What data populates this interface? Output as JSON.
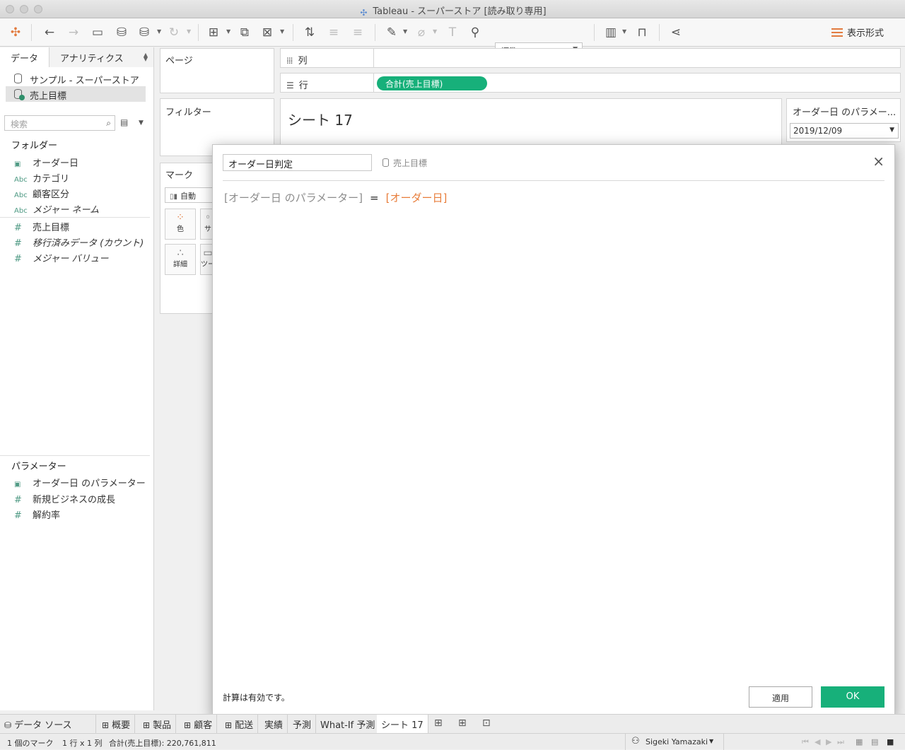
{
  "window": {
    "title": "Tableau - スーパーストア [読み取り専用]"
  },
  "toolbar": {
    "fit_value": "標準",
    "show_me_label": "表示形式"
  },
  "data_pane": {
    "tabs": [
      "データ",
      "アナリティクス"
    ],
    "data_sources": [
      "サンプル - スーパーストア",
      "売上目標"
    ],
    "search_placeholder": "検索",
    "folder_title": "フォルダー",
    "dimensions": [
      {
        "icon": "calendar-icon",
        "label": "オーダー日"
      },
      {
        "icon": "abc-icon",
        "icon_text": "Abc",
        "label": "カテゴリ"
      },
      {
        "icon": "abc-icon",
        "icon_text": "Abc",
        "label": "顧客区分"
      },
      {
        "icon": "abc-icon",
        "icon_text": "Abc",
        "label": "メジャー ネーム"
      }
    ],
    "measures": [
      {
        "icon": "number-icon",
        "icon_text": "#",
        "label": "売上目標"
      },
      {
        "icon": "number-icon",
        "icon_text": "#",
        "label": "移行済みデータ (カウント)"
      },
      {
        "icon": "number-icon",
        "icon_text": "#",
        "label": "メジャー バリュー"
      }
    ],
    "parameters_title": "パラメーター",
    "parameters": [
      {
        "icon": "calendar-icon",
        "label": "オーダー日 のパラメーター"
      },
      {
        "icon": "number-icon",
        "icon_text": "#",
        "label": "新規ビジネスの成長"
      },
      {
        "icon": "number-icon",
        "icon_text": "#",
        "label": "解約率"
      }
    ]
  },
  "shelves": {
    "pages_label": "ページ",
    "filters_label": "フィルター",
    "marks_label": "マーク",
    "mark_type": "自動",
    "mark_buttons": [
      "色",
      "サ",
      "詳細",
      "ツー"
    ],
    "columns_label": "列",
    "rows_label": "行",
    "rows_pill": "合計(売上目標)"
  },
  "view": {
    "title": "シート 17",
    "param_card_title": "オーダー日 のパラメー...",
    "param_value": "2019/12/09"
  },
  "calc_dialog": {
    "name": "オーダー日判定",
    "data_source": "売上目標",
    "formula_param": "[オーダー日 のパラメーター]",
    "formula_op": "=",
    "formula_field": "[オーダー日]",
    "status": "計算は有効です。",
    "apply_label": "適用",
    "ok_label": "OK"
  },
  "sheet_tabs": {
    "data_source_tab": "データ ソース",
    "tabs": [
      "概要",
      "製品",
      "顧客",
      "配送",
      "実績",
      "予測",
      "What-If 予測",
      "シート 17"
    ]
  },
  "status_bar": {
    "marks": "1 個のマーク",
    "rows_cols": "1 行 x 1 列",
    "sum": "合計(売上目標): 220,761,811",
    "user": "Sigeki Yamazaki"
  },
  "colors": {
    "accent_green": "#17b07a",
    "field_orange": "#e87d3a",
    "dim_teal": "#4f9a84"
  }
}
